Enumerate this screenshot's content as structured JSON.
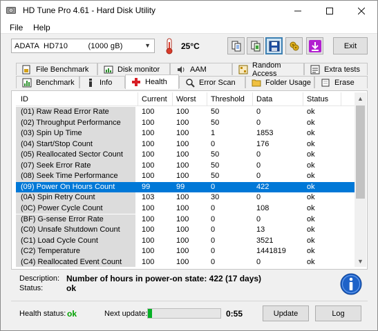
{
  "window": {
    "title": "HD Tune Pro 4.61 - Hard Disk Utility"
  },
  "menu": {
    "file": "File",
    "help": "Help"
  },
  "toolbar": {
    "drive": "ADATA  HD710         (1000 gB)",
    "temperature": "25°C",
    "exit_label": "Exit"
  },
  "tabs_top": [
    "File Benchmark",
    "Disk monitor",
    "AAM",
    "Random Access",
    "Extra tests"
  ],
  "tabs_bottom": [
    "Benchmark",
    "Info",
    "Health",
    "Error Scan",
    "Folder Usage",
    "Erase"
  ],
  "table": {
    "headers": [
      "ID",
      "Current",
      "Worst",
      "Threshold",
      "Data",
      "Status"
    ],
    "rows": [
      [
        "(01) Raw Read Error Rate",
        "100",
        "100",
        "50",
        "0",
        "ok"
      ],
      [
        "(02) Throughput Performance",
        "100",
        "100",
        "50",
        "0",
        "ok"
      ],
      [
        "(03) Spin Up Time",
        "100",
        "100",
        "1",
        "1853",
        "ok"
      ],
      [
        "(04) Start/Stop Count",
        "100",
        "100",
        "0",
        "176",
        "ok"
      ],
      [
        "(05) Reallocated Sector Count",
        "100",
        "100",
        "50",
        "0",
        "ok"
      ],
      [
        "(07) Seek Error Rate",
        "100",
        "100",
        "50",
        "0",
        "ok"
      ],
      [
        "(08) Seek Time Performance",
        "100",
        "100",
        "50",
        "0",
        "ok"
      ],
      [
        "(09) Power On Hours Count",
        "99",
        "99",
        "0",
        "422",
        "ok"
      ],
      [
        "(0A) Spin Retry Count",
        "103",
        "100",
        "30",
        "0",
        "ok"
      ],
      [
        "(0C) Power Cycle Count",
        "100",
        "100",
        "0",
        "108",
        "ok"
      ],
      [
        "(BF) G-sense Error Rate",
        "100",
        "100",
        "0",
        "0",
        "ok"
      ],
      [
        "(C0) Unsafe Shutdown Count",
        "100",
        "100",
        "0",
        "13",
        "ok"
      ],
      [
        "(C1) Load Cycle Count",
        "100",
        "100",
        "0",
        "3521",
        "ok"
      ],
      [
        "(C2) Temperature",
        "100",
        "100",
        "0",
        "1441819",
        "ok"
      ],
      [
        "(C4) Reallocated Event Count",
        "100",
        "100",
        "0",
        "0",
        "ok"
      ]
    ],
    "selected_row": 7
  },
  "details": {
    "description_label": "Description:",
    "description": "Number of hours in power-on state: 422 (17 days)",
    "status_label": "Status:",
    "status": "ok"
  },
  "footer": {
    "health_label": "Health status:",
    "health_value": "ok",
    "next_update_label": "Next update:",
    "next_update_progress": 0.06,
    "timer": "0:55",
    "update_label": "Update",
    "log_label": "Log"
  },
  "colors": {
    "selection": "#0078d7",
    "health_ok": "#00a000",
    "progress": "#06b025"
  },
  "icons": [
    "hdd-icon",
    "thermometer-icon",
    "copy-info-icon",
    "copy-screen-icon",
    "save-icon",
    "options-icon",
    "download-icon",
    "info-icon"
  ]
}
